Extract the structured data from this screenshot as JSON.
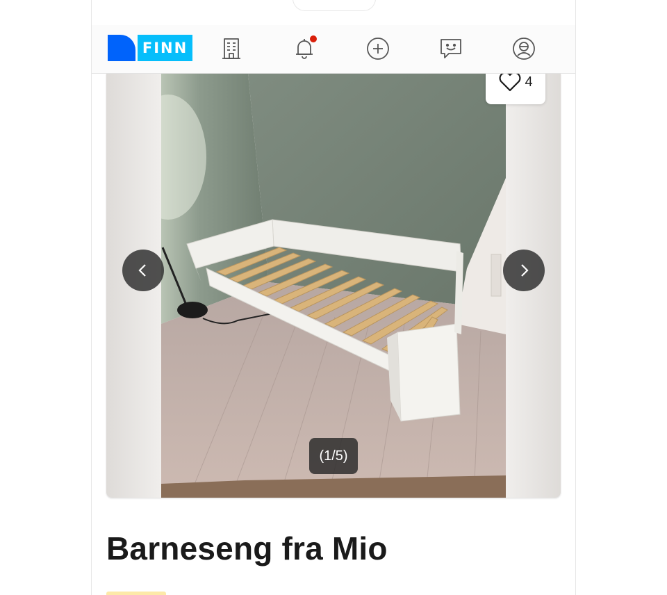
{
  "nav": {
    "logo_text": "FINN",
    "items": [
      {
        "icon": "building-icon",
        "label": "Jobb/Bedrift"
      },
      {
        "icon": "bell-icon",
        "label": "Varsler",
        "has_notification_dot": true
      },
      {
        "icon": "plus-circle-icon",
        "label": "Ny annonse"
      },
      {
        "icon": "chat-icon",
        "label": "Meldinger"
      },
      {
        "icon": "profile-icon",
        "label": "Min FINN"
      }
    ]
  },
  "gallery": {
    "favorite_count": "4",
    "image_counter": "(1/5)",
    "image_description": "photo-of-bed"
  },
  "listing": {
    "title": "Barneseng fra Mio"
  },
  "colors": {
    "finn_blue": "#0063fb",
    "finn_cyan": "#06befb",
    "notification_red": "#d91f0a"
  }
}
